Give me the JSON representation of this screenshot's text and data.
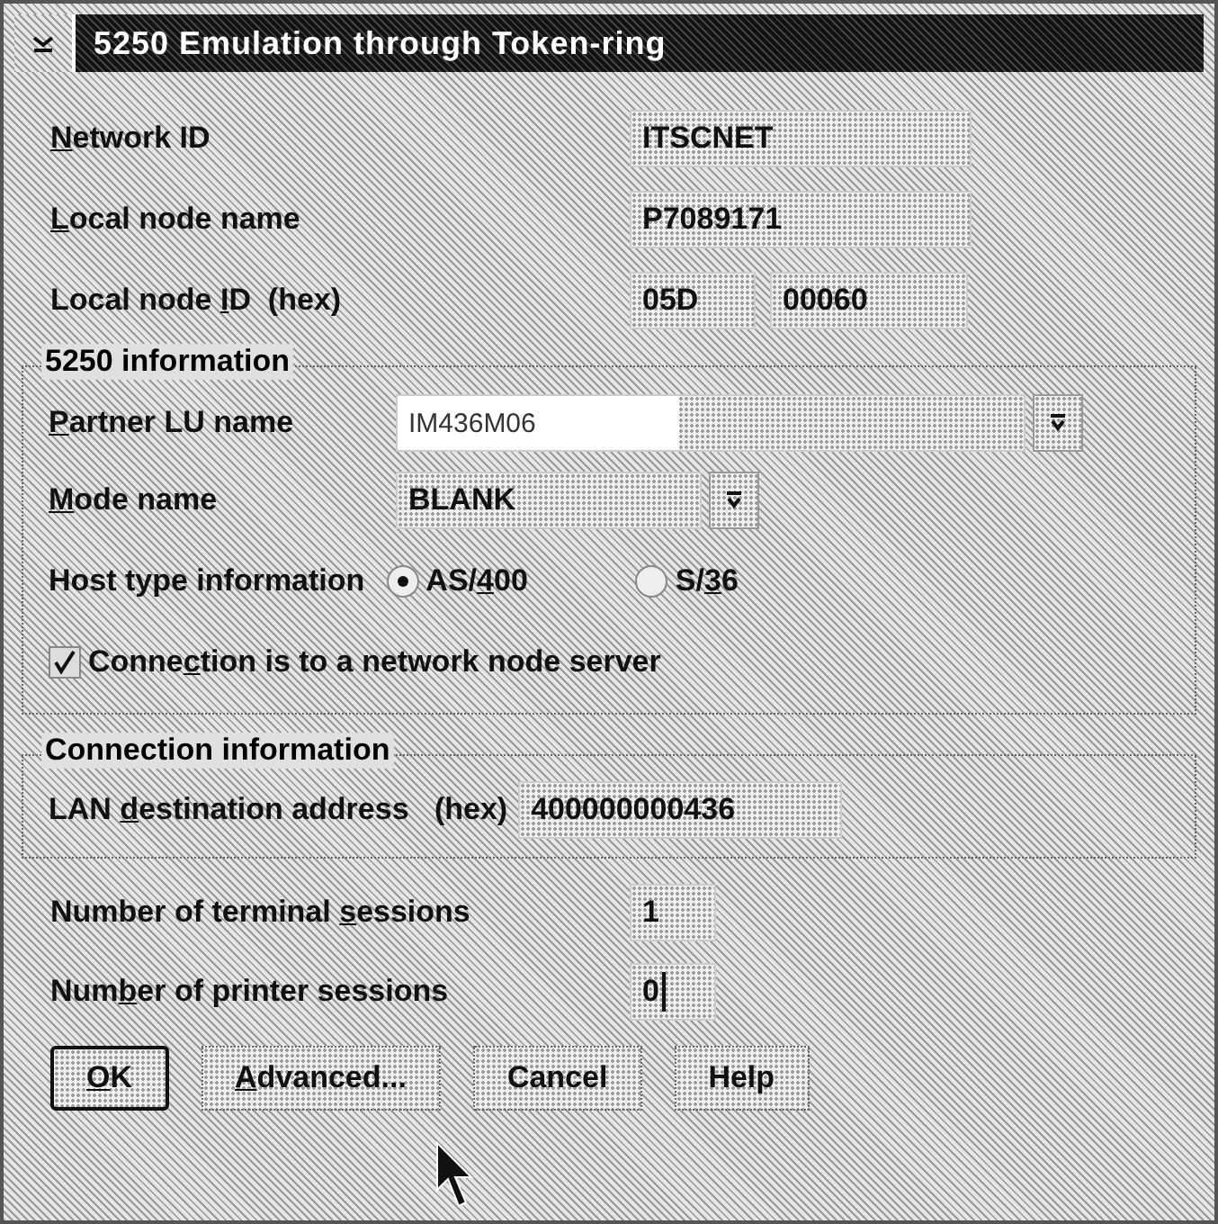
{
  "window": {
    "title": "5250 Emulation through Token-ring"
  },
  "fields": [
    {
      "label": {
        "key": "N",
        "post": "etwork ID"
      },
      "values": [
        "ITSCNET"
      ]
    },
    {
      "label": {
        "key": "L",
        "post": "ocal node name"
      },
      "values": [
        "P7089171"
      ]
    },
    {
      "label": {
        "pre": "Local node ",
        "key": "I",
        "post": "D  (hex)"
      },
      "values": [
        "05D",
        "00060"
      ]
    }
  ],
  "info_group": {
    "title": "5250 information",
    "partner": {
      "label": {
        "key": "P",
        "post": "artner LU name"
      },
      "value": "IM436M06"
    },
    "mode": {
      "label": {
        "key": "M",
        "post": "ode name"
      },
      "value": "BLANK"
    },
    "host_type": {
      "label": "Host type information",
      "options": [
        {
          "label": {
            "pre": "AS/",
            "key": "4",
            "post": "00"
          },
          "selected": true
        },
        {
          "label": {
            "pre": "S/",
            "key": "3",
            "post": "6"
          },
          "selected": false
        }
      ]
    },
    "checkbox": {
      "label": {
        "pre": "Conne",
        "key": "c",
        "post": "tion is to a network node server"
      },
      "checked": true
    }
  },
  "connection_group": {
    "title": "Connection information",
    "label": {
      "pre": "LAN ",
      "key": "d",
      "post": "estination address   (hex)"
    },
    "value": "400000000436"
  },
  "sessions": [
    {
      "label": {
        "pre": "Number of terminal ",
        "key": "s",
        "post": "essions"
      },
      "value": "1",
      "focused": false
    },
    {
      "label": {
        "pre": "Num",
        "key": "b",
        "post": "er of printer sessions"
      },
      "value": "0",
      "focused": true
    }
  ],
  "buttons": [
    {
      "label": {
        "key": "O",
        "post": "K"
      },
      "default": true
    },
    {
      "label": {
        "key": "A",
        "post": "dvanced..."
      },
      "default": false
    },
    {
      "label": {
        "pre": "Cancel"
      },
      "default": false
    },
    {
      "label": {
        "pre": "Help"
      },
      "default": false
    }
  ]
}
